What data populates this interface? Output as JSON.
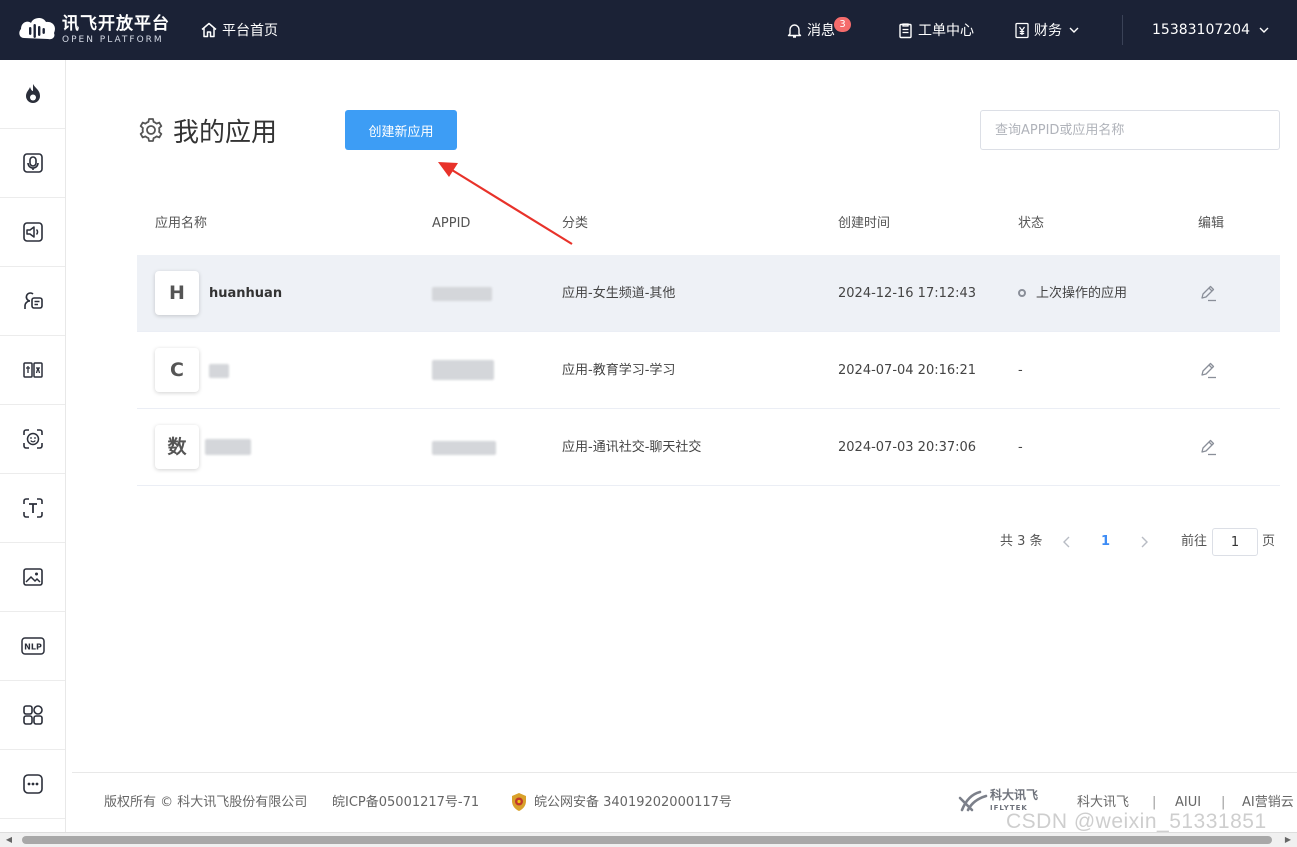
{
  "header": {
    "logo_title": "讯飞开放平台",
    "logo_subtitle": "OPEN PLATFORM",
    "home_label": "平台首页",
    "messages_label": "消息",
    "messages_badge": "3",
    "tickets_label": "工单中心",
    "finance_label": "财务",
    "account_label": "15383107204"
  },
  "sidebar": {
    "items": [
      {
        "icon": "flame-icon"
      },
      {
        "icon": "microphone-icon"
      },
      {
        "icon": "speaker-icon"
      },
      {
        "icon": "voice-chat-icon"
      },
      {
        "icon": "translate-icon"
      },
      {
        "icon": "face-icon"
      },
      {
        "icon": "text-recognition-icon"
      },
      {
        "icon": "image-icon"
      },
      {
        "icon": "nlp-icon"
      },
      {
        "icon": "apps-grid-icon"
      },
      {
        "icon": "more-icon"
      }
    ]
  },
  "page": {
    "title": "我的应用",
    "create_button": "创建新应用",
    "search_placeholder": "查询APPID或应用名称"
  },
  "table": {
    "columns": [
      "应用名称",
      "APPID",
      "分类",
      "创建时间",
      "状态",
      "编辑"
    ],
    "rows": [
      {
        "avatar": "H",
        "name": "huanhuan",
        "appid": "",
        "category": "应用-女生频道-其他",
        "created": "2024-12-16 17:12:43",
        "status": "上次操作的应用",
        "active": true
      },
      {
        "avatar": "C",
        "name": "",
        "appid": "",
        "category": "应用-教育学习-学习",
        "created": "2024-07-04 20:16:21",
        "status": "-",
        "active": false
      },
      {
        "avatar": "数",
        "name": "",
        "appid": "",
        "category": "应用-通讯社交-聊天社交",
        "created": "2024-07-03 20:37:06",
        "status": "-",
        "active": false
      }
    ]
  },
  "pagination": {
    "total": "共 3 条",
    "current_page": "1",
    "goto_prefix": "前往",
    "goto_value": "1",
    "goto_suffix": "页"
  },
  "footer": {
    "copyright": "版权所有 © 科大讯飞股份有限公司",
    "icp": "皖ICP备05001217号-71",
    "police": "皖公网安备 34019202000117号",
    "brand_cn": "科大讯飞",
    "brand_en": "IFLYTEK",
    "links": [
      "科大讯飞",
      "AIUI",
      "AI营销云"
    ],
    "separator": "|"
  },
  "watermark": "CSDN @weixin_51331851",
  "colors": {
    "topbar": "#1b2236",
    "primary": "#3d9df5",
    "annotation_arrow": "#e8322a",
    "badge": "#f56c6c"
  }
}
